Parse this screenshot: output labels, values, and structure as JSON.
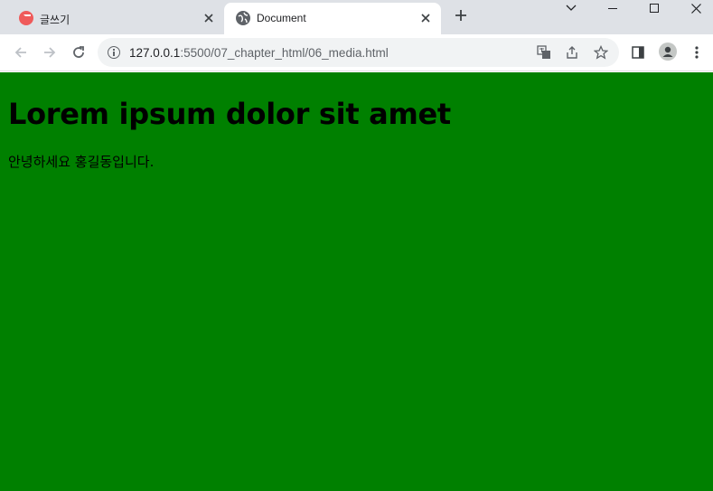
{
  "tabs": [
    {
      "title": "글쓰기",
      "active": false
    },
    {
      "title": "Document",
      "active": true
    }
  ],
  "omnibox": {
    "host": "127.0.0.1",
    "path": ":5500/07_chapter_html/06_media.html"
  },
  "page": {
    "heading": "Lorem ipsum dolor sit amet",
    "paragraph": "안녕하세요 홍길동입니다.",
    "background_color": "#008000"
  }
}
